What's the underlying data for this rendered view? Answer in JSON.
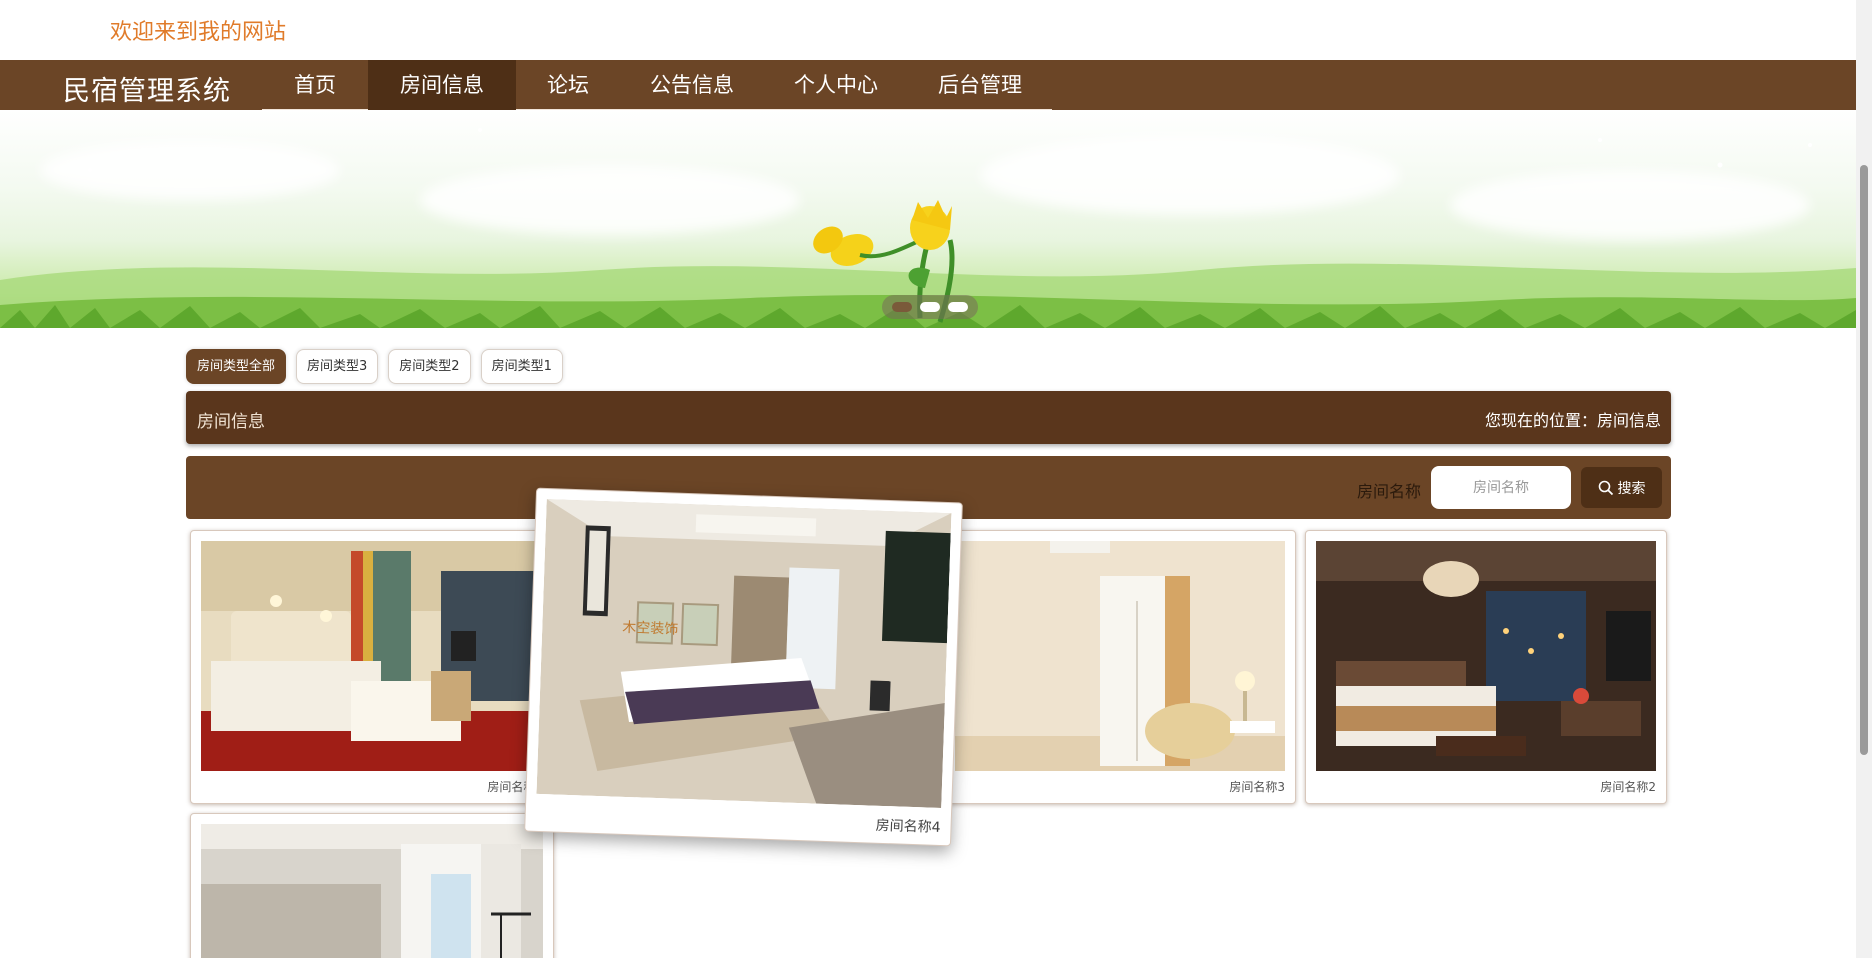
{
  "header": {
    "welcome": "欢迎来到我的网站"
  },
  "nav": {
    "brand": "民宿管理系统",
    "items": [
      {
        "label": "首页",
        "active": false
      },
      {
        "label": "房间信息",
        "active": true
      },
      {
        "label": "论坛",
        "active": false
      },
      {
        "label": "公告信息",
        "active": false
      },
      {
        "label": "个人中心",
        "active": false
      },
      {
        "label": "后台管理",
        "active": false
      }
    ]
  },
  "banner": {
    "slides": 3,
    "active_slide": 1
  },
  "room_types": [
    {
      "label": "房间类型全部",
      "active": true
    },
    {
      "label": "房间类型3",
      "active": false
    },
    {
      "label": "房间类型2",
      "active": false
    },
    {
      "label": "房间类型1",
      "active": false
    }
  ],
  "section": {
    "title": "房间信息",
    "location": "您现在的位置：房间信息"
  },
  "search": {
    "label": "房间名称",
    "placeholder": "房间名称",
    "button": "搜索"
  },
  "rooms": [
    {
      "name": "房间名称5"
    },
    {
      "name": "房间名称4"
    },
    {
      "name": "房间名称3"
    },
    {
      "name": "房间名称2"
    },
    {
      "name": ""
    }
  ],
  "colors": {
    "primary": "#6b4526",
    "primary_dark": "#4e2f16",
    "welcome": "#e07b2a"
  }
}
